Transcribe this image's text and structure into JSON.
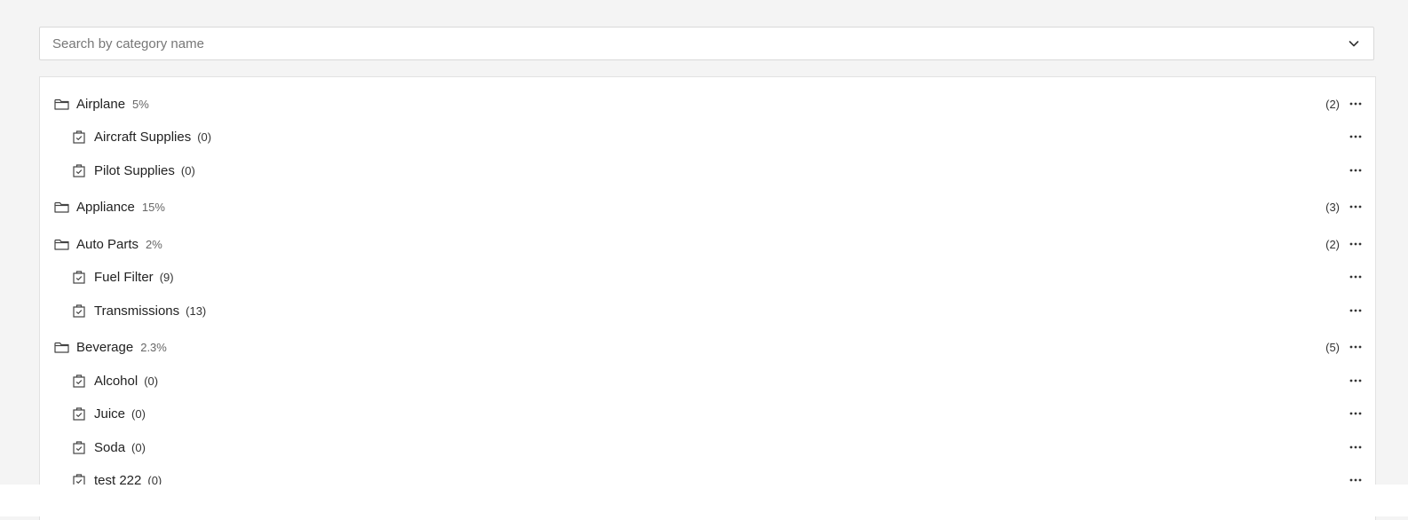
{
  "search": {
    "placeholder": "Search by category name"
  },
  "colors": {
    "background": "#f4f4f4",
    "panel": "#ffffff",
    "border": "#d9d9d9",
    "text": "#222222",
    "muted": "#666666"
  },
  "icons": {
    "parent": "folder-icon",
    "child": "shopping-bag-check-icon",
    "menu": "more-horizontal-icon",
    "dropdown": "chevron-down-icon"
  },
  "categories": [
    {
      "name": "Airplane",
      "percent": "5%",
      "count": "(2)",
      "children": [
        {
          "name": "Aircraft Supplies",
          "count": "(0)"
        },
        {
          "name": "Pilot Supplies",
          "count": "(0)"
        }
      ]
    },
    {
      "name": "Appliance",
      "percent": "15%",
      "count": "(3)",
      "children": []
    },
    {
      "name": "Auto Parts",
      "percent": "2%",
      "count": "(2)",
      "children": [
        {
          "name": "Fuel Filter",
          "count": "(9)"
        },
        {
          "name": "Transmissions",
          "count": "(13)"
        }
      ]
    },
    {
      "name": "Beverage",
      "percent": "2.3%",
      "count": "(5)",
      "children": [
        {
          "name": "Alcohol",
          "count": "(0)"
        },
        {
          "name": "Juice",
          "count": "(0)"
        },
        {
          "name": "Soda",
          "count": "(0)"
        },
        {
          "name": "test 222",
          "count": "(0)"
        }
      ]
    }
  ]
}
